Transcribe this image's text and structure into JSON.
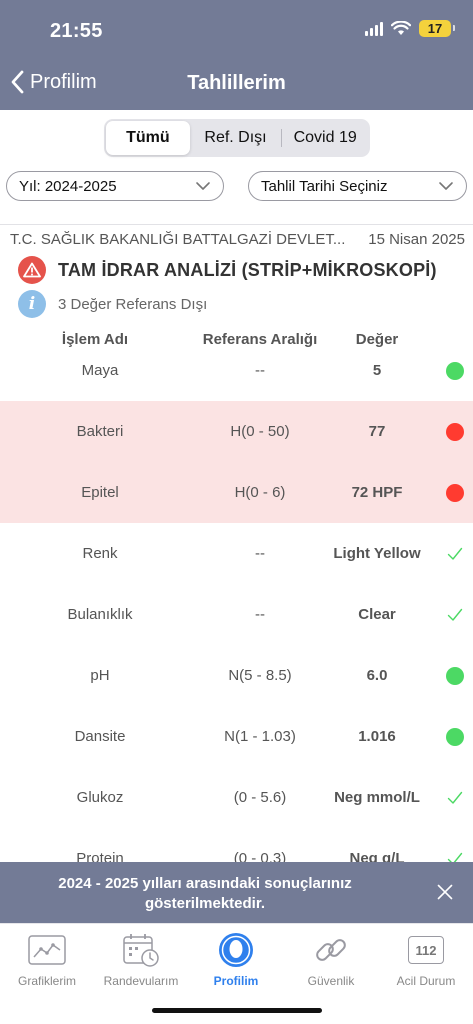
{
  "status_bar": {
    "time": "21:55",
    "battery": "17",
    "icons": [
      "signal-icon",
      "wifi-icon",
      "battery-icon"
    ]
  },
  "nav": {
    "back_label": "Profilim",
    "title": "Tahlillerim"
  },
  "segments": [
    {
      "label": "Tümü",
      "active": true
    },
    {
      "label": "Ref. Dışı",
      "active": false
    },
    {
      "label": "Covid 19",
      "active": false
    }
  ],
  "filters": {
    "year": "Yıl: 2024-2025",
    "date": "Tahlil Tarihi Seçiniz"
  },
  "report": {
    "hospital": "T.C. SAĞLIK BAKANLIĞI BATTALGAZİ DEVLET...",
    "date": "15 Nisan 2025",
    "test_name": "TAM İDRAR ANALİZİ (STRİP+MİKROSKOPİ)",
    "info": "3 Değer Referans Dışı"
  },
  "table": {
    "headers": {
      "name": "İşlem Adı",
      "range": "Referans Aralığı",
      "value": "Değer"
    },
    "rows": [
      {
        "name": "Maya",
        "range": "--",
        "value": "5",
        "status": "normal"
      },
      {
        "name": "Bakteri",
        "range": "H(0 - 50)",
        "value": "77",
        "status": "high"
      },
      {
        "name": "Epitel",
        "range": "H(0 - 6)",
        "value": "72 HPF",
        "status": "high"
      },
      {
        "name": "Renk",
        "range": "--",
        "value": "Light Yellow",
        "status": "check"
      },
      {
        "name": "Bulanıklık",
        "range": "--",
        "value": "Clear",
        "status": "check"
      },
      {
        "name": "pH",
        "range": "N(5 - 8.5)",
        "value": "6.0",
        "status": "normal"
      },
      {
        "name": "Dansite",
        "range": "N(1 - 1.03)",
        "value": "1.016",
        "status": "normal"
      },
      {
        "name": "Glukoz",
        "range": "(0 - 5.6)",
        "value": "Neg mmol/L",
        "status": "check"
      },
      {
        "name": "Protein",
        "range": "(0 - 0.3)",
        "value": "Neg g/L",
        "status": "check"
      }
    ]
  },
  "banner": {
    "text": "2024 - 2025 yılları arasındaki sonuçlarınız gösterilmektedir."
  },
  "tabbar": {
    "items": [
      {
        "label": "Grafiklerim",
        "icon": "chart-icon",
        "active": false
      },
      {
        "label": "Randevularım",
        "icon": "calendar-icon",
        "active": false
      },
      {
        "label": "Profilim",
        "icon": "profile-icon",
        "active": true
      },
      {
        "label": "Güvenlik",
        "icon": "link-icon",
        "active": false
      },
      {
        "label": "Acil Durum",
        "icon": "emergency-112-icon",
        "active": false
      }
    ],
    "emergency_number": "112"
  },
  "colors": {
    "header": "#737b96",
    "alert_row": "#fbe3e3",
    "status_green": "#4cd964",
    "status_red": "#ff3b30",
    "active_tab": "#2f80ed"
  }
}
